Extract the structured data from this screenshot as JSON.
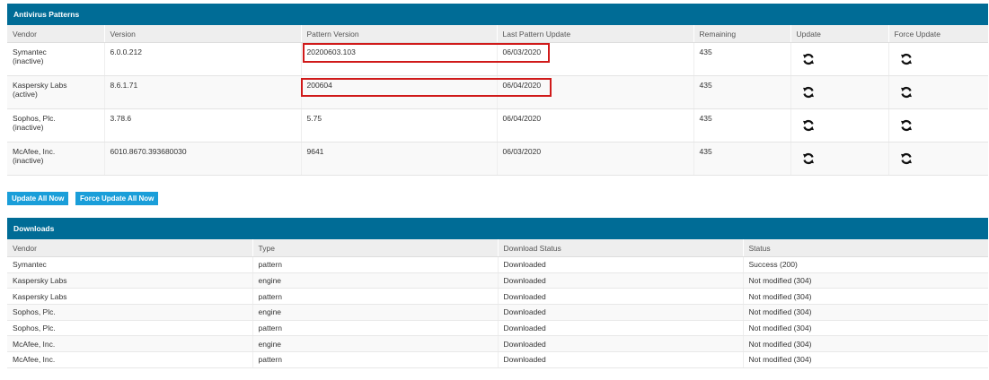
{
  "antivirus": {
    "title": "Antivirus Patterns",
    "columns": [
      "Vendor",
      "Version",
      "Pattern Version",
      "Last Pattern Update",
      "Remaining",
      "Update",
      "Force Update"
    ],
    "rows": [
      {
        "vendor": "Symantec",
        "state": "(inactive)",
        "version": "6.0.0.212",
        "pattern_version": "20200603.103",
        "last_update": "06/03/2020",
        "remaining": "435"
      },
      {
        "vendor": "Kaspersky Labs",
        "state": "(active)",
        "version": "8.6.1.71",
        "pattern_version": "200604",
        "last_update": "06/04/2020",
        "remaining": "435"
      },
      {
        "vendor": "Sophos, Plc.",
        "state": "(inactive)",
        "version": "3.78.6",
        "pattern_version": "5.75",
        "last_update": "06/04/2020",
        "remaining": "435"
      },
      {
        "vendor": "McAfee, Inc.",
        "state": "(inactive)",
        "version": "6010.8670.393680030",
        "pattern_version": "9641",
        "last_update": "06/03/2020",
        "remaining": "435"
      }
    ],
    "update_icon": "refresh-icon",
    "force_update_icon": "refresh-icon"
  },
  "buttons": {
    "update_all": "Update All Now",
    "force_update_all": "Force Update All Now"
  },
  "downloads": {
    "title": "Downloads",
    "columns": [
      "Vendor",
      "Type",
      "Download Status",
      "Status"
    ],
    "rows": [
      {
        "vendor": "Symantec",
        "type": "pattern",
        "download_status": "Downloaded",
        "status": "Success (200)"
      },
      {
        "vendor": "Kaspersky Labs",
        "type": "engine",
        "download_status": "Downloaded",
        "status": "Not modified (304)"
      },
      {
        "vendor": "Kaspersky Labs",
        "type": "pattern",
        "download_status": "Downloaded",
        "status": "Not modified (304)"
      },
      {
        "vendor": "Sophos, Plc.",
        "type": "engine",
        "download_status": "Downloaded",
        "status": "Not modified (304)"
      },
      {
        "vendor": "Sophos, Plc.",
        "type": "pattern",
        "download_status": "Downloaded",
        "status": "Not modified (304)"
      },
      {
        "vendor": "McAfee, Inc.",
        "type": "engine",
        "download_status": "Downloaded",
        "status": "Not modified (304)"
      },
      {
        "vendor": "McAfee, Inc.",
        "type": "pattern",
        "download_status": "Downloaded",
        "status": "Not modified (304)"
      }
    ]
  },
  "colors": {
    "header_bar": "#006c96",
    "button": "#1a9ed9",
    "annotation": "#d01a1a"
  }
}
